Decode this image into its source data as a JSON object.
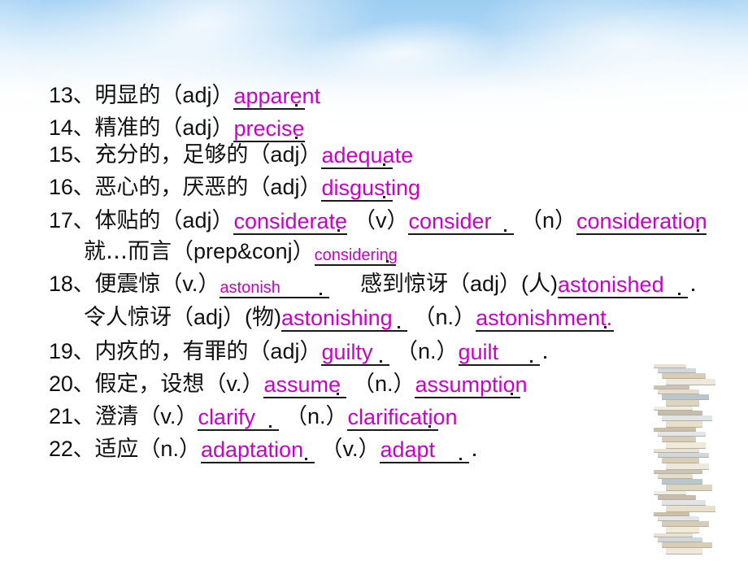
{
  "slide": {
    "background_top_color": "#9ccdf2",
    "background_bottom_color": "#ffffff",
    "answer_color": "#cc00cc",
    "text_color": "#111111"
  },
  "vocab_items": [
    {
      "number": "13、",
      "chinese": "明显的",
      "segments": [
        {
          "pos": "（adj）",
          "answer": "apparent",
          "blank_width": 88,
          "answer_size": "normal"
        }
      ]
    },
    {
      "number": "14、",
      "chinese": "精准的",
      "segments": [
        {
          "pos": "（adj）",
          "answer": "precise",
          "blank_width": 88,
          "answer_size": "normal"
        }
      ]
    },
    {
      "number": "15、",
      "chinese": "充分的，足够的",
      "segments": [
        {
          "pos": "（adj）",
          "answer": "adequate",
          "blank_width": 88,
          "answer_size": "normal"
        }
      ]
    },
    {
      "number": "16、",
      "chinese": "恶心的，厌恶的",
      "segments": [
        {
          "pos": "（adj）",
          "answer": "disgusting",
          "blank_width": 88,
          "answer_size": "normal"
        }
      ]
    },
    {
      "number": "17、",
      "chinese": "体贴的",
      "segments": [
        {
          "pos": "（adj）",
          "answer": "considerate",
          "blank_width": 140,
          "answer_size": "normal"
        },
        {
          "pos": "（v）",
          "answer": "consider",
          "blank_width": 130,
          "answer_size": "normal"
        },
        {
          "pos": "（n）",
          "answer": "consideration",
          "blank_width": 160,
          "answer_size": "normal"
        }
      ]
    },
    {
      "number": "",
      "chinese": "就…而言",
      "indent": true,
      "segments": [
        {
          "pos": "（prep&conj）",
          "answer": "considering",
          "blank_width": 100,
          "answer_size": "small"
        }
      ]
    },
    {
      "number": "18、",
      "chinese": "便震惊",
      "segments": [
        {
          "pos": "（v.）",
          "answer": "astonish",
          "blank_width": 135,
          "answer_size": "small"
        },
        {
          "label": "感到惊讶",
          "pos": "（adj）(人)",
          "answer": "astonished",
          "blank_width": 160,
          "answer_size": "normal",
          "trailing_dot": true
        }
      ]
    },
    {
      "number": "",
      "chinese": "令人惊讶",
      "indent": true,
      "segments": [
        {
          "pos": "（adj）(物)",
          "answer": "astonishing",
          "blank_width": 155,
          "answer_size": "normal"
        },
        {
          "pos": "（n.）",
          "answer": "astonishment.",
          "blank_width": 170,
          "answer_size": "normal"
        }
      ]
    },
    {
      "number": "19、",
      "chinese": "内疚的，有罪的",
      "segments": [
        {
          "pos": "（adj）",
          "answer": "guilty",
          "blank_width": 84,
          "answer_size": "normal"
        },
        {
          "pos": "（n.）",
          "answer": "guilt",
          "blank_width": 100,
          "answer_size": "normal",
          "trailing_dot": true
        }
      ]
    },
    {
      "number": "20、",
      "chinese": "假定，设想",
      "segments": [
        {
          "pos": "（v.）",
          "answer": "assume",
          "blank_width": 102,
          "answer_size": "normal"
        },
        {
          "pos": "（n.）",
          "answer": "assumption",
          "blank_width": 130,
          "answer_size": "normal"
        }
      ]
    },
    {
      "number": "21、",
      "chinese": "澄清",
      "segments": [
        {
          "pos": "（v.）",
          "answer": "clarify",
          "blank_width": 100,
          "answer_size": "normal"
        },
        {
          "pos": "（n.）",
          "answer": "clarification",
          "blank_width": 112,
          "answer_size": "normal"
        }
      ]
    },
    {
      "number": "22、",
      "chinese": "适应",
      "segments": [
        {
          "pos": "（n.）",
          "answer": "adaptation",
          "blank_width": 140,
          "answer_size": "normal"
        },
        {
          "pos": "（v.）",
          "answer": "adapt",
          "blank_width": 110,
          "answer_size": "normal",
          "trailing_dot": true
        }
      ]
    }
  ],
  "decorations": {
    "book_stack_label": "stack-of-books-image"
  }
}
